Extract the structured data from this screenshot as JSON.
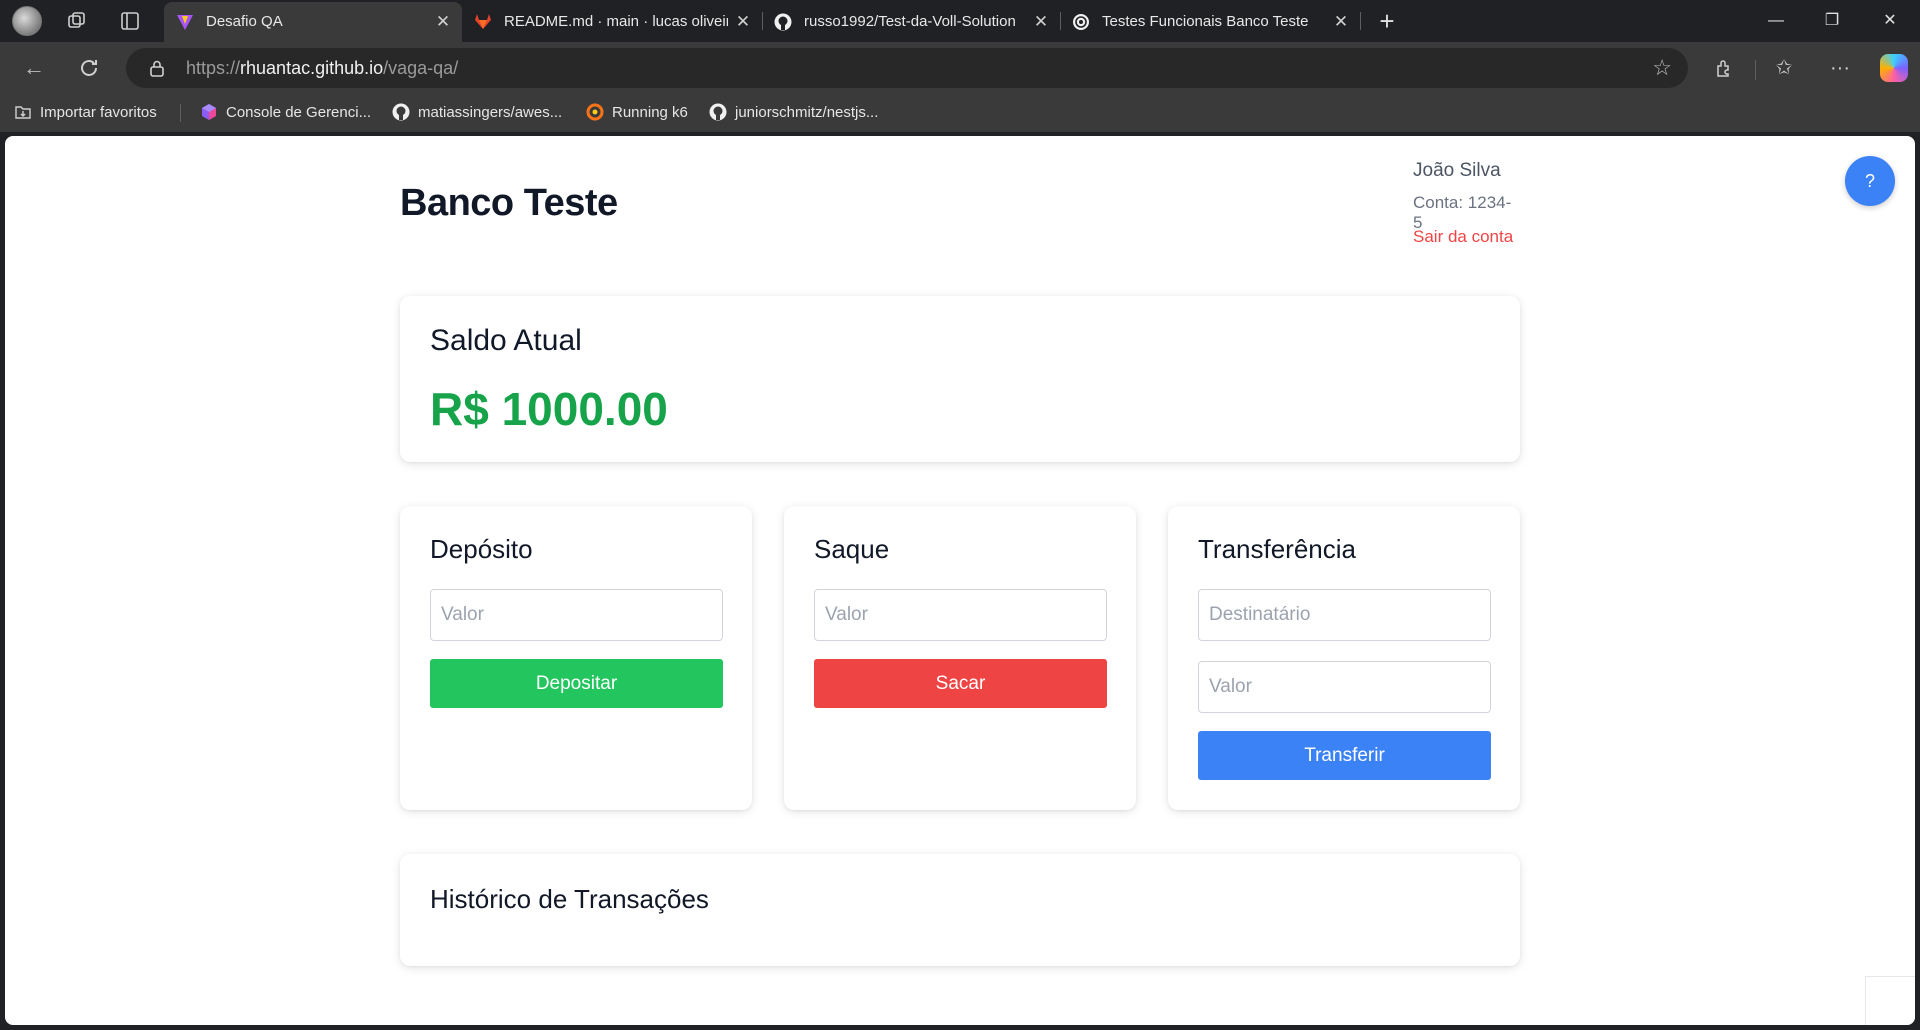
{
  "browser": {
    "tabs": [
      {
        "title": "Desafio QA",
        "active": true,
        "favicon": "vite-icon"
      },
      {
        "title": "README.md · main · lucas oliveira",
        "active": false,
        "favicon": "gitlab-icon"
      },
      {
        "title": "russo1992/Test-da-Voll-Solution",
        "active": false,
        "favicon": "github-icon"
      },
      {
        "title": "Testes Funcionais Banco Teste",
        "active": false,
        "favicon": "openai-icon"
      }
    ],
    "address": {
      "scheme": "https://",
      "host": "rhuantac.github.io",
      "path": "/vaga-qa/"
    },
    "bookmarks": [
      {
        "label": "Importar favoritos",
        "icon": "import-icon"
      },
      {
        "label": "Console de Gerenci...",
        "icon": "cube-icon"
      },
      {
        "label": "matiassingers/awes...",
        "icon": "github-icon"
      },
      {
        "label": "Running k6",
        "icon": "grafana-icon"
      },
      {
        "label": "juniorschmitz/nestjs...",
        "icon": "github-icon"
      }
    ]
  },
  "app": {
    "title": "Banco Teste",
    "user": {
      "name": "João Silva",
      "account": "Conta: 1234-5",
      "logout": "Sair da conta"
    },
    "balance": {
      "heading": "Saldo Atual",
      "value": "R$ 1000.00"
    },
    "deposit": {
      "heading": "Depósito",
      "placeholder": "Valor",
      "button": "Depositar"
    },
    "withdraw": {
      "heading": "Saque",
      "placeholder": "Valor",
      "button": "Sacar"
    },
    "transfer": {
      "heading": "Transferência",
      "recipient_placeholder": "Destinatário",
      "amount_placeholder": "Valor",
      "button": "Transferir"
    },
    "history": {
      "heading": "Histórico de Transações"
    },
    "help_label": "?"
  },
  "colors": {
    "balance": "#16a34a",
    "deposit_button": "#22c55e",
    "withdraw_button": "#ef4444",
    "transfer_button": "#3b82f6",
    "logout_link": "#ef4444"
  }
}
